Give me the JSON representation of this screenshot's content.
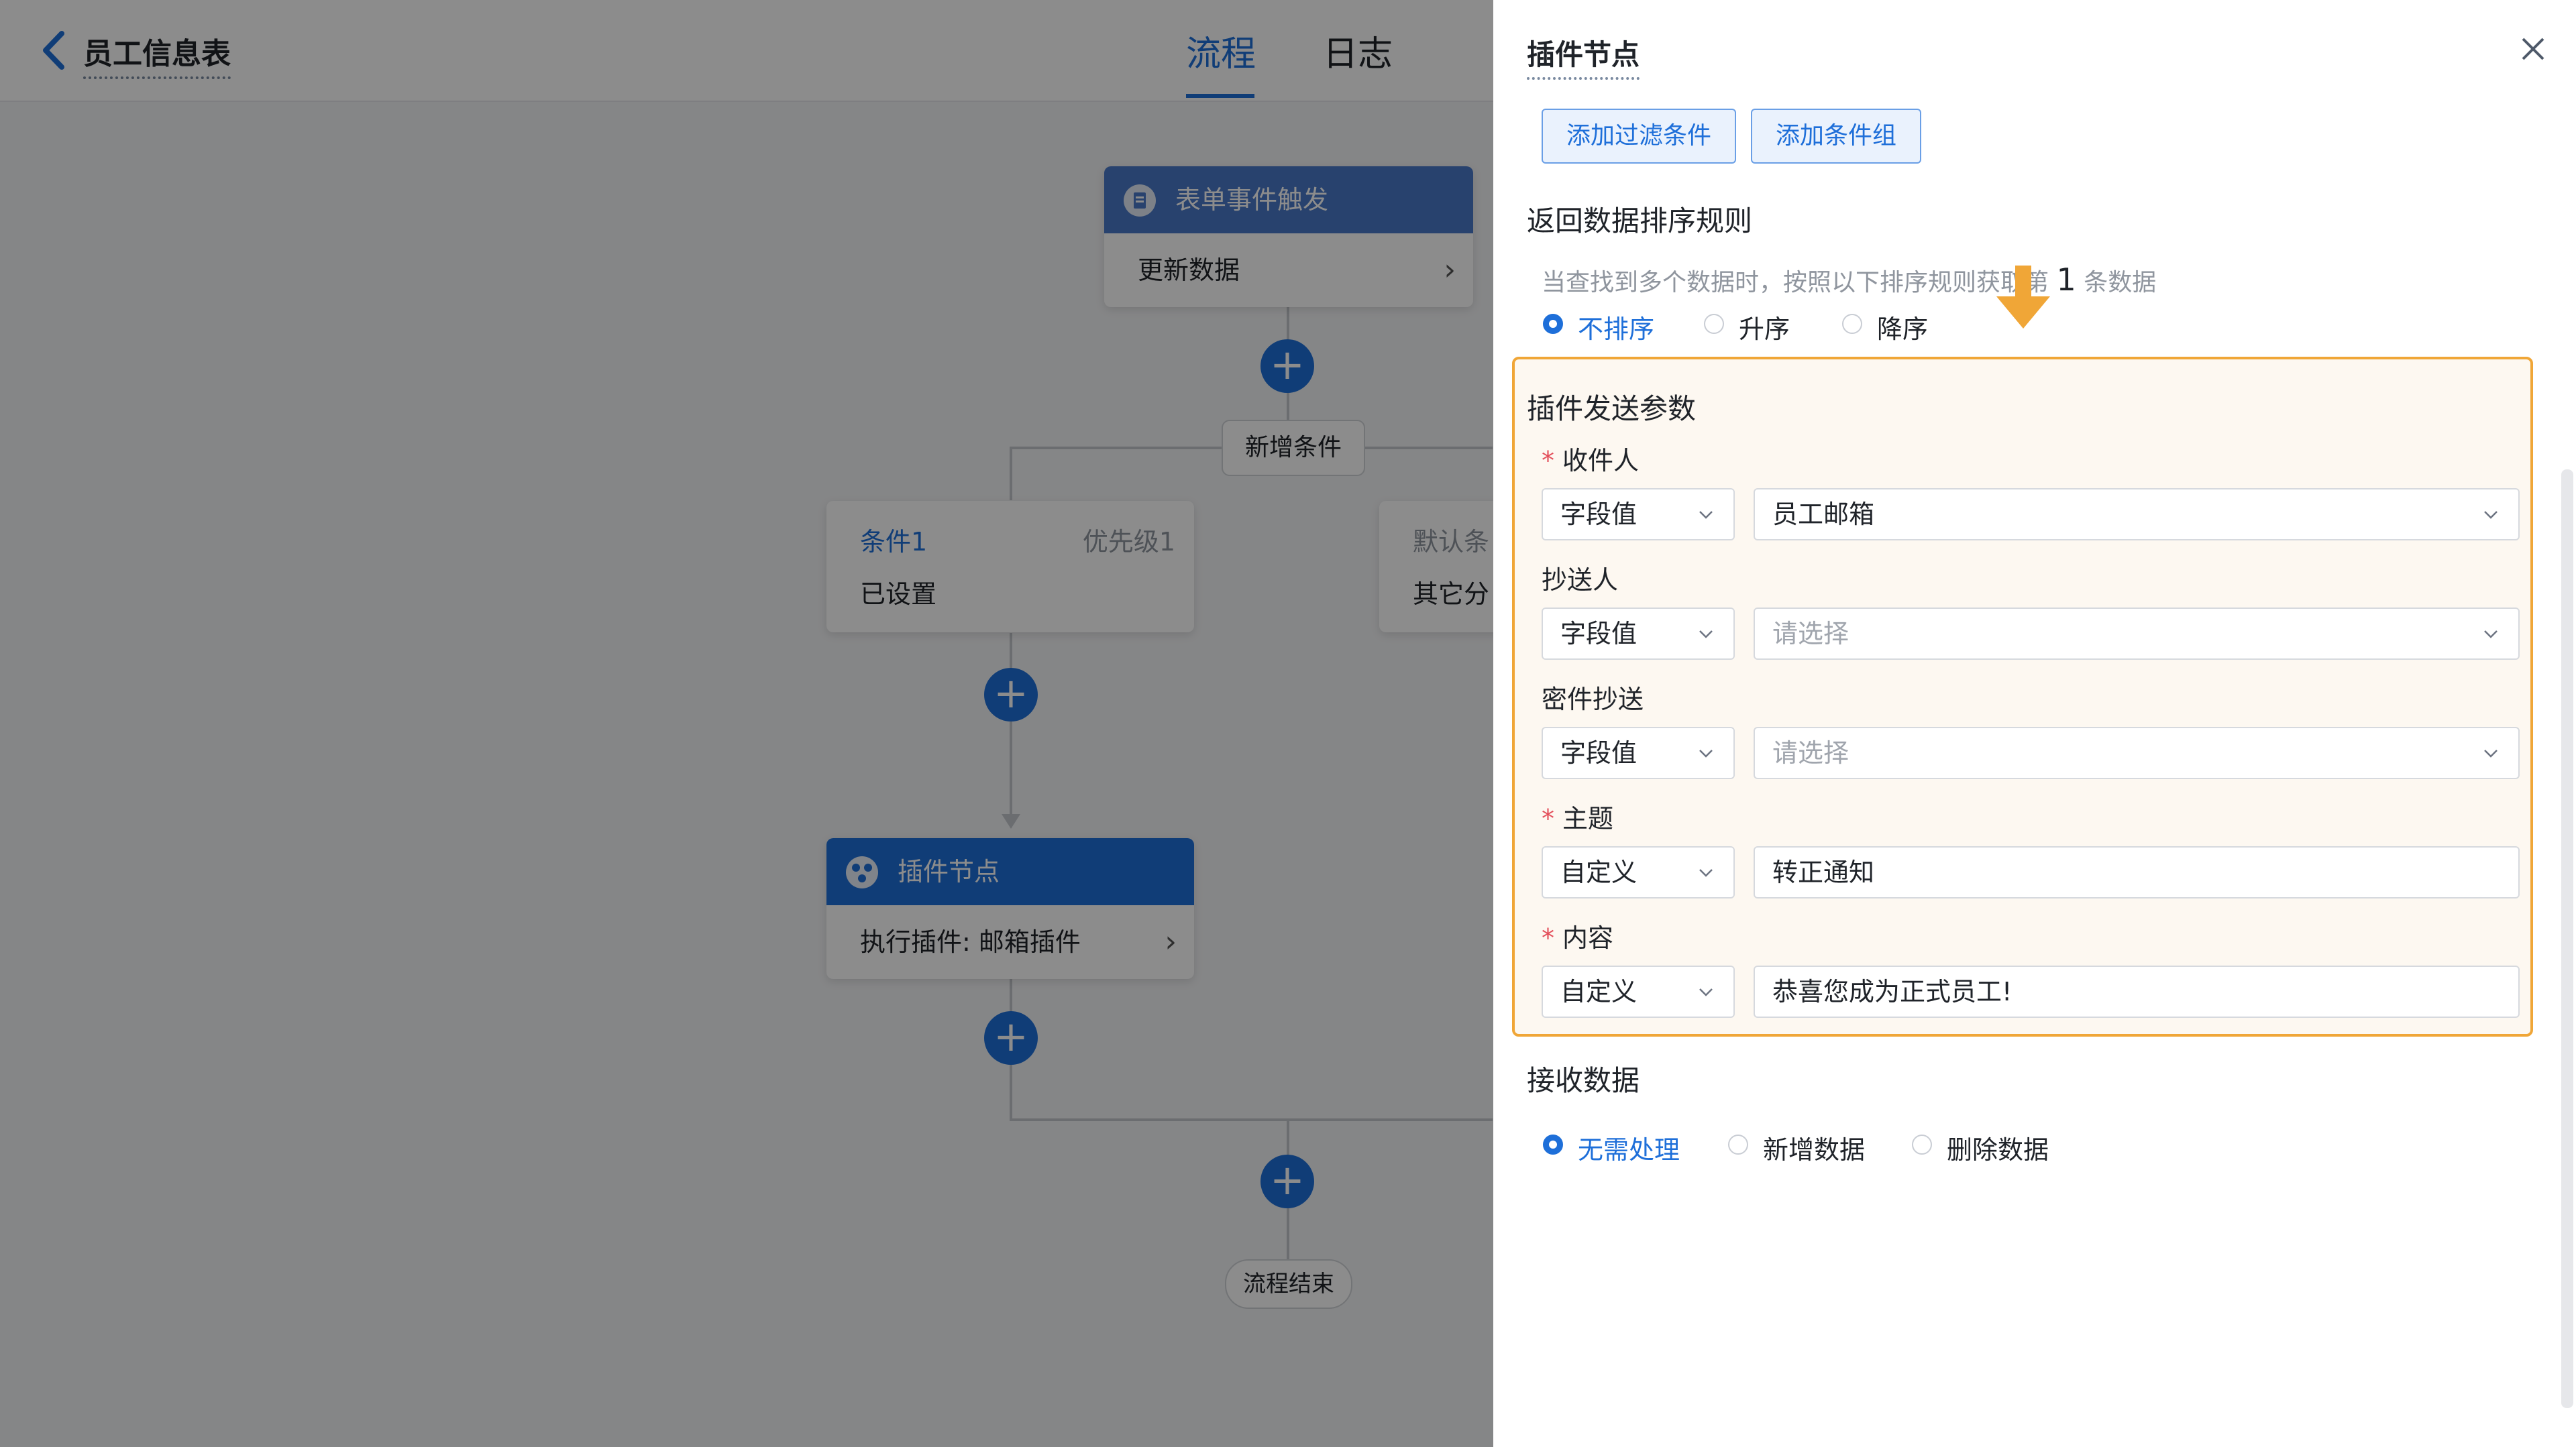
{
  "header": {
    "title": "员工信息表",
    "tabs": [
      {
        "label": "流程",
        "active": true
      },
      {
        "label": "日志",
        "active": false
      }
    ]
  },
  "flow": {
    "trigger_node": {
      "title": "表单事件触发",
      "body": "更新数据"
    },
    "add_condition_label": "新增条件",
    "condition_1": {
      "title": "条件1",
      "priority": "优先级1",
      "status": "已设置"
    },
    "default_condition": {
      "title": "默认条",
      "body": "其它分"
    },
    "plugin_node": {
      "title": "插件节点",
      "body": "执行插件: 邮箱插件"
    },
    "end_label": "流程结束",
    "add_symbol": "+"
  },
  "drawer": {
    "title": "插件节点",
    "buttons": {
      "add_filter": "添加过滤条件",
      "add_group": "添加条件组"
    },
    "sort": {
      "title": "返回数据排序规则",
      "hint_prefix": "当查找到多个数据时，按照以下排序规则获取第",
      "hint_count": "1",
      "hint_suffix": "条数据",
      "options": [
        {
          "label": "不排序",
          "selected": true
        },
        {
          "label": "升序",
          "selected": false
        },
        {
          "label": "降序",
          "selected": false
        }
      ]
    },
    "params": {
      "title": "插件发送参数",
      "fields": [
        {
          "label": "收件人",
          "required": true,
          "type": "字段值",
          "value": "员工邮箱",
          "placeholder": ""
        },
        {
          "label": "抄送人",
          "required": false,
          "type": "字段值",
          "value": "",
          "placeholder": "请选择"
        },
        {
          "label": "密件抄送",
          "required": false,
          "type": "字段值",
          "value": "",
          "placeholder": "请选择"
        },
        {
          "label": "主题",
          "required": true,
          "type": "自定义",
          "value": "转正通知",
          "placeholder": ""
        },
        {
          "label": "内容",
          "required": true,
          "type": "自定义",
          "value": "恭喜您成为正式员工!",
          "placeholder": ""
        }
      ]
    },
    "receive": {
      "title": "接收数据",
      "options": [
        {
          "label": "无需处理",
          "selected": true
        },
        {
          "label": "新增数据",
          "selected": false
        },
        {
          "label": "删除数据",
          "selected": false
        }
      ]
    }
  },
  "colors": {
    "primary": "#1e6fd9",
    "highlight": "#f0a637",
    "required": "#e34d59"
  }
}
